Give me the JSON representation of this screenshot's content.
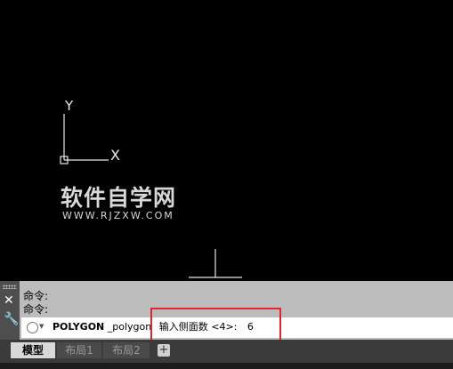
{
  "ucs": {
    "y_label": "Y",
    "x_label": "X"
  },
  "watermark": {
    "main": "软件自学网",
    "sub": "WWW.RJZXW.COM"
  },
  "command_history": [
    "命令:",
    "命令:"
  ],
  "command_line": {
    "command": "POLYGON",
    "sub": "_polygon",
    "prompt": "输入侧面数 <4>:",
    "value": "6"
  },
  "layout_tabs": {
    "model": "模型",
    "layout1": "布局1",
    "layout2": "布局2",
    "add": "+"
  },
  "colors": {
    "highlight": "#e0262a",
    "canvas": "#000000"
  }
}
